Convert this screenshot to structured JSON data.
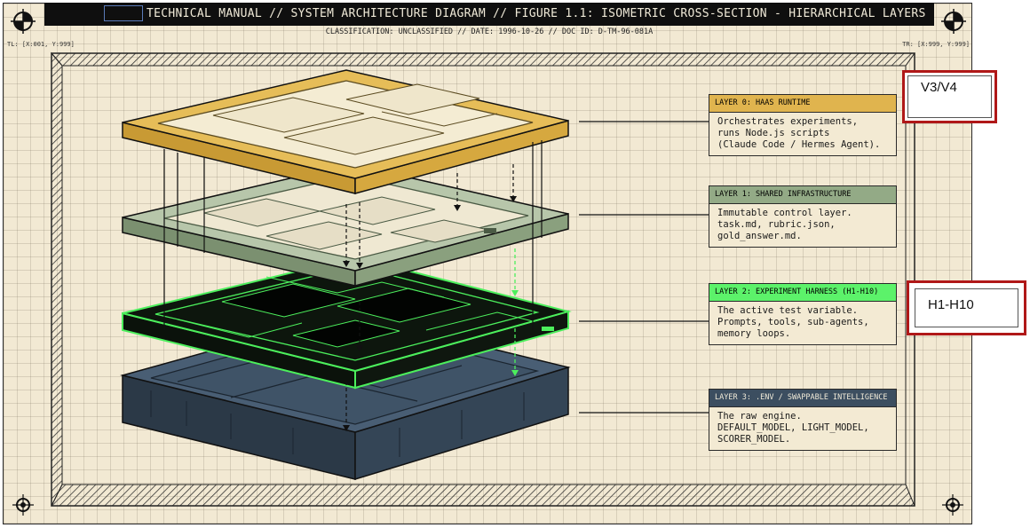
{
  "header": {
    "title": "TECHNICAL MANUAL // SYSTEM ARCHITECTURE DIAGRAM // FIGURE 1.1: ISOMETRIC CROSS-SECTION - HIERARCHICAL LAYERS",
    "subtitle": "CLASSIFICATION: UNCLASSIFIED // DATE: 1996-10-26 // DOC ID: D-TM-96-081A"
  },
  "coords": {
    "tl": "TL: [X:001, Y:999]",
    "tr": "TR: [X:999, Y:999]"
  },
  "layers": [
    {
      "label": "LAYER 0: HAAS RUNTIME",
      "lines": [
        "Orchestrates experiments,",
        "runs Node.js scripts",
        "(Claude Code / Hermes Agent)."
      ],
      "color": "#e0b44e"
    },
    {
      "label": "LAYER 1: SHARED INFRASTRUCTURE",
      "lines": [
        "Immutable control layer.",
        "task.md, rubric.json,",
        "gold_answer.md."
      ],
      "color": "#93aa86"
    },
    {
      "label": "LAYER 2: EXPERIMENT HARNESS (H1-H10)",
      "lines": [
        "The active test variable.",
        "Prompts, tools, sub-agents,",
        "memory loops."
      ],
      "color": "#5cf26a"
    },
    {
      "label": "LAYER 3: .ENV / SWAPPABLE INTELLIGENCE",
      "lines": [
        "The raw engine.",
        "DEFAULT_MODEL, LIGHT_MODEL,",
        "SCORER_MODEL."
      ],
      "color": "#3c4e60"
    }
  ],
  "overlays": {
    "top": "V3/V4",
    "middle": "H1-H10"
  }
}
